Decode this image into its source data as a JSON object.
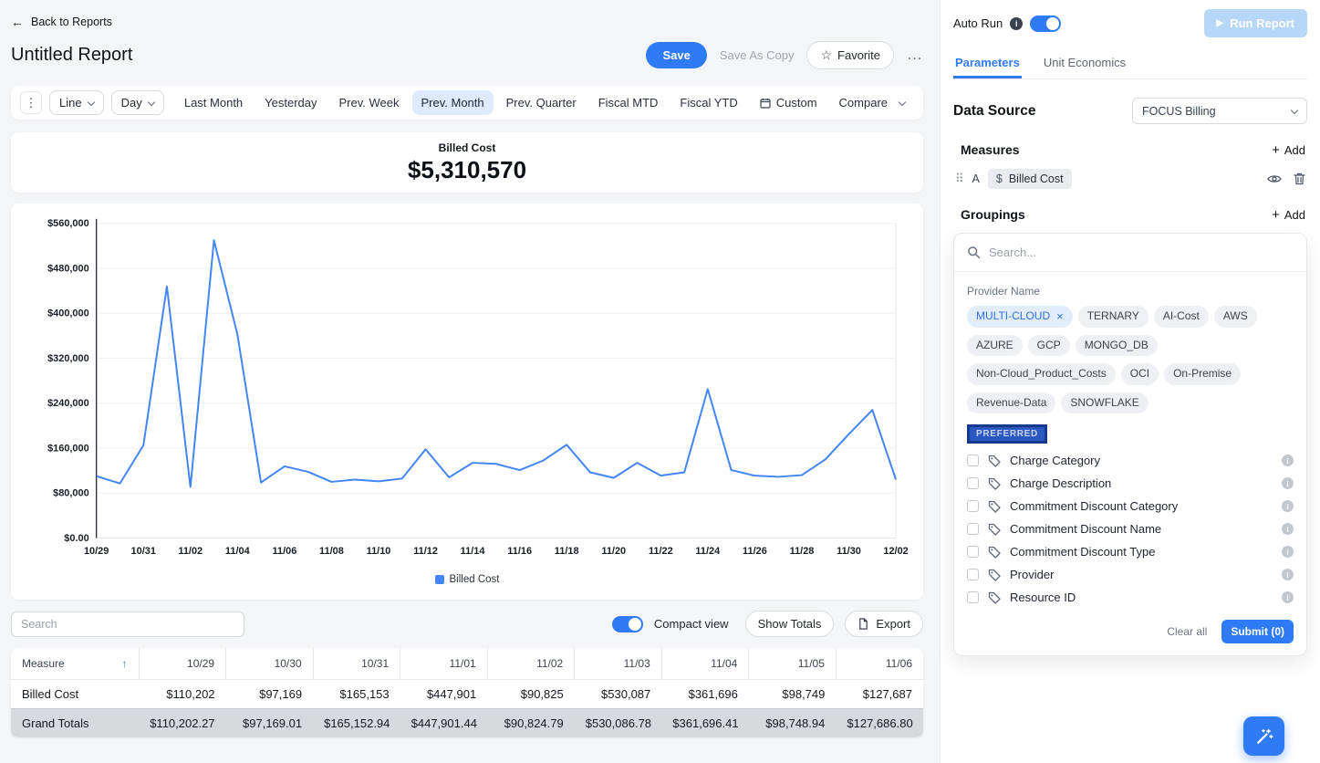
{
  "header": {
    "back_label": "Back to Reports",
    "title": "Untitled Report",
    "save_label": "Save",
    "save_as_copy_label": "Save As Copy",
    "favorite_label": "Favorite",
    "more_label": "…"
  },
  "toolbar": {
    "chart_type_value": "Line",
    "granularity_value": "Day",
    "presets": [
      "Last Month",
      "Yesterday",
      "Prev. Week",
      "Prev. Month",
      "Prev. Quarter",
      "Fiscal MTD",
      "Fiscal YTD",
      "Custom",
      "Compare"
    ],
    "active_preset": "Prev. Month"
  },
  "kpi": {
    "label": "Billed Cost",
    "value": "$5,310,570"
  },
  "chart_data": {
    "type": "line",
    "title": "Billed Cost",
    "legend": "Billed Cost",
    "line_color": "#4285f4",
    "ylim": [
      0,
      560000
    ],
    "y_tick_step": 80000,
    "y_tick_labels": [
      "$0.00",
      "$80,000",
      "$160,000",
      "$240,000",
      "$320,000",
      "$400,000",
      "$480,000",
      "$560,000"
    ],
    "x": [
      "10/29",
      "10/30",
      "10/31",
      "11/01",
      "11/02",
      "11/03",
      "11/04",
      "11/05",
      "11/06",
      "11/07",
      "11/08",
      "11/09",
      "11/10",
      "11/11",
      "11/12",
      "11/13",
      "11/14",
      "11/15",
      "11/16",
      "11/17",
      "11/18",
      "11/19",
      "11/20",
      "11/21",
      "11/22",
      "11/23",
      "11/24",
      "11/25",
      "11/26",
      "11/27",
      "11/28",
      "11/29",
      "11/30",
      "12/01",
      "12/02"
    ],
    "series": [
      {
        "name": "Billed Cost",
        "values": [
          110202,
          97169,
          165153,
          447901,
          90825,
          530087,
          361696,
          98749,
          127687,
          118000,
          100000,
          104000,
          101000,
          106000,
          158000,
          108000,
          134000,
          132000,
          121000,
          138000,
          166000,
          117000,
          107000,
          134000,
          111000,
          117000,
          265000,
          121000,
          111000,
          109000,
          112000,
          140000,
          185000,
          228000,
          104000
        ]
      }
    ]
  },
  "table_controls": {
    "search_placeholder": "Search",
    "compact_view_label": "Compact view",
    "compact_view_on": true,
    "show_totals_label": "Show Totals",
    "export_label": "Export"
  },
  "table": {
    "columns": [
      "Measure",
      "10/29",
      "10/30",
      "10/31",
      "11/01",
      "11/02",
      "11/03",
      "11/04",
      "11/05",
      "11/06"
    ],
    "rows": [
      {
        "label": "Billed Cost",
        "values": [
          "$110,202",
          "$97,169",
          "$165,153",
          "$447,901",
          "$90,825",
          "$530,087",
          "$361,696",
          "$98,749",
          "$127,687"
        ]
      }
    ],
    "totals": {
      "label": "Grand Totals",
      "values": [
        "$110,202.27",
        "$97,169.01",
        "$165,152.94",
        "$447,901.44",
        "$90,824.79",
        "$530,086.78",
        "$361,696.41",
        "$98,748.94",
        "$127,686.80"
      ]
    }
  },
  "panel": {
    "auto_run_label": "Auto Run",
    "auto_run_on": true,
    "run_report_label": "Run Report",
    "tabs": [
      "Parameters",
      "Unit Economics"
    ],
    "active_tab": "Parameters",
    "data_source_label": "Data Source",
    "data_source_value": "FOCUS Billing",
    "measures_label": "Measures",
    "add_label": "Add",
    "measure_row": {
      "index_label": "A",
      "chip_prefix": "$",
      "chip": "Billed Cost"
    },
    "groupings_label": "Groupings",
    "search_placeholder": "Search...",
    "provider_group_label": "Provider Name",
    "provider_selected": "MULTI-CLOUD",
    "provider_options": [
      "MULTI-CLOUD",
      "TERNARY",
      "AI-Cost",
      "AWS",
      "AZURE",
      "GCP",
      "MONGO_DB",
      "Non-Cloud_Product_Costs",
      "OCI",
      "On-Premise",
      "Revenue-Data",
      "SNOWFLAKE"
    ],
    "preferred_label": "PREFERRED",
    "grouping_options": [
      "Charge Category",
      "Charge Description",
      "Commitment Discount Category",
      "Commitment Discount Name",
      "Commitment Discount Type",
      "Provider",
      "Resource ID"
    ],
    "clear_all_label": "Clear all",
    "submit_label": "Submit (0)"
  },
  "colors": {
    "accent": "#2f7af5",
    "chart_line": "#4285f4",
    "selected_preset_bg": "#dfeafc",
    "grand_totals_bg": "#d7d9dd"
  }
}
